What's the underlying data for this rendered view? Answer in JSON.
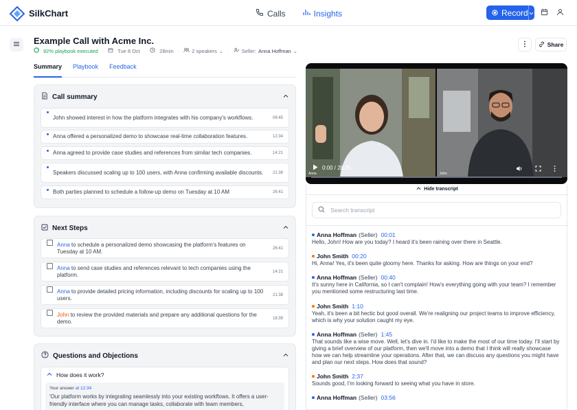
{
  "app": {
    "name": "SilkChart"
  },
  "nav": {
    "calls": "Calls",
    "insights": "Insights"
  },
  "record": {
    "label": "Record"
  },
  "header": {
    "title": "Example Call with Acme Inc.",
    "playbook": "92% playbook executed",
    "date": "Tue 8 Oct",
    "duration": "28min",
    "speakers": "2 speakers",
    "seller_label": "Seller:",
    "seller_name": "Anna Hoffman",
    "share": "Share"
  },
  "tabs": [
    "Summary",
    "Playbook",
    "Feedback"
  ],
  "call_summary": {
    "title": "Call summary",
    "items": [
      {
        "text": "John showed interest in how the platform integrates with his company's workflows.",
        "time": "08:45"
      },
      {
        "text": "Anna offered a personalized demo to showcase real-time collaboration features.",
        "time": "12:34"
      },
      {
        "text": "Anna agreed to provide case studies and references from similar tech companies.",
        "time": "14:21"
      },
      {
        "text": "Speakers discussed scaling up to 100 users, with Anna confirming available discounts.",
        "time": "21:38"
      },
      {
        "text": "Both parties planned to schedule a follow-up demo on Tuesday at 10 AM",
        "time": "26:41"
      }
    ]
  },
  "next_steps": {
    "title": "Next Steps",
    "items": [
      {
        "who": "Anna",
        "text": " to schedule a personalized demo showcasing the platform's features on Tuesday at 10 AM.",
        "time": "26:41"
      },
      {
        "who": "Anna",
        "text": " to send case studies and references relevant to tech companies using the platform.",
        "time": "14:21"
      },
      {
        "who": "Anna",
        "text": " to provide detailed pricing information, including discounts for scaling up to 100 users.",
        "time": "21:38"
      },
      {
        "who": "John",
        "text": " to review the provided materials and prepare any additional questions for the demo.",
        "time": "18:39"
      }
    ]
  },
  "questions": {
    "title": "Questions and Objections",
    "q1": "How does it work?",
    "answer_label": "Your answer",
    "answer_at": "at",
    "answer_time": "12:34",
    "answer_text": "'Our platform works by integrating seamlessly into your existing workflows. It offers a user-friendly interface where you can manage tasks, collaborate with team members,"
  },
  "video": {
    "time": "0:00 / 28:25",
    "label_left": "Anna",
    "label_right": "John",
    "progress": 0
  },
  "transcript": {
    "hide_label": "Hide transcript",
    "search_placeholder": "Search transcript",
    "entries": [
      {
        "name": "Anna Hoffman",
        "role": "(Seller)",
        "time": "00:01",
        "color": "#2563eb",
        "text": "Hello, John! How are you today? I heard it's been raining over there in Seattle."
      },
      {
        "name": "John Smith",
        "role": "",
        "time": "00:20",
        "color": "#f97316",
        "text": "Hi, Anna! Yes, it's been quite gloomy here. Thanks for asking. How are things on your end?"
      },
      {
        "name": "Anna Hoffman",
        "role": "(Seller)",
        "time": "00:40",
        "color": "#2563eb",
        "text": "It's sunny here in California, so I can't complain! How's everything going with your team? I remember you mentioned some restructuring last time."
      },
      {
        "name": "John Smith",
        "role": "",
        "time": "1:10",
        "color": "#f97316",
        "text": "Yeah, it's been a bit hectic but good overall. We're realigning our project teams to improve efficiency, which is why your solution caught my eye."
      },
      {
        "name": "Anna Hoffman",
        "role": "(Seller)",
        "time": "1:45",
        "color": "#2563eb",
        "text": "That sounds like a wise move. Well, let's dive in. I'd like to make the most of our time today. I'll start by giving a brief overview of our platform, then we'll move into a demo that I think will really showcase how we can help streamline your operations. After that, we can discuss any questions you might have and plan our next steps. How does that sound?"
      },
      {
        "name": "John Smith",
        "role": "",
        "time": "2:37",
        "color": "#f97316",
        "text": "Sounds good, I'm looking forward to seeing what you have in store."
      },
      {
        "name": "Anna Hoffman",
        "role": "(Seller)",
        "time": "03:56",
        "color": "#2563eb",
        "text": ""
      }
    ]
  }
}
